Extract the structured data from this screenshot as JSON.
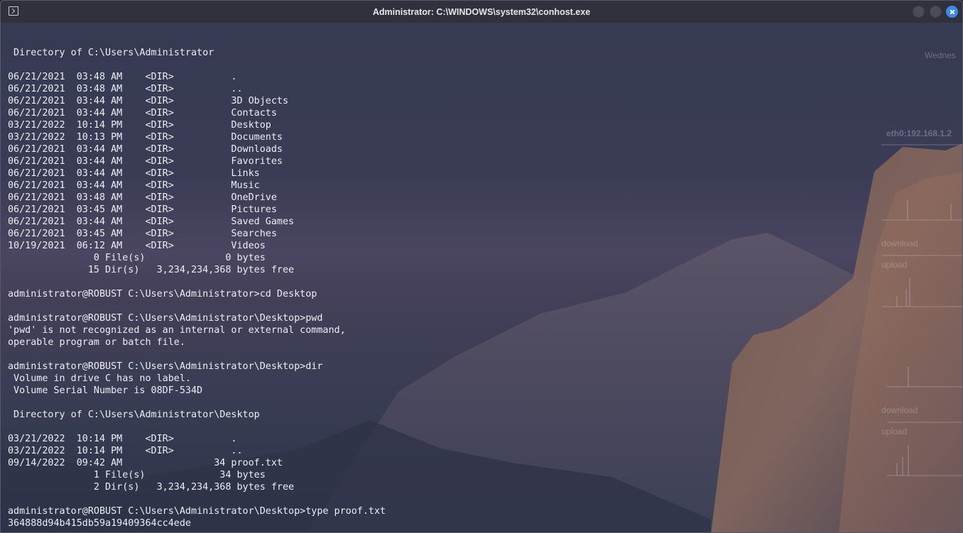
{
  "window": {
    "title": "Administrator: C:\\WINDOWS\\system32\\conhost.exe",
    "close_color": "#3d8ae6"
  },
  "console": {
    "lines": [
      "",
      "",
      " Directory of C:\\Users\\Administrator",
      "",
      "06/21/2021  03:48 AM    <DIR>          .",
      "06/21/2021  03:48 AM    <DIR>          ..",
      "06/21/2021  03:44 AM    <DIR>          3D Objects",
      "06/21/2021  03:44 AM    <DIR>          Contacts",
      "03/21/2022  10:14 PM    <DIR>          Desktop",
      "03/21/2022  10:13 PM    <DIR>          Documents",
      "06/21/2021  03:44 AM    <DIR>          Downloads",
      "06/21/2021  03:44 AM    <DIR>          Favorites",
      "06/21/2021  03:44 AM    <DIR>          Links",
      "06/21/2021  03:44 AM    <DIR>          Music",
      "06/21/2021  03:48 AM    <DIR>          OneDrive",
      "06/21/2021  03:45 AM    <DIR>          Pictures",
      "06/21/2021  03:44 AM    <DIR>          Saved Games",
      "06/21/2021  03:45 AM    <DIR>          Searches",
      "10/19/2021  06:12 AM    <DIR>          Videos",
      "               0 File(s)              0 bytes",
      "              15 Dir(s)   3,234,234,368 bytes free",
      "",
      "administrator@ROBUST C:\\Users\\Administrator>cd Desktop",
      "",
      "administrator@ROBUST C:\\Users\\Administrator\\Desktop>pwd",
      "'pwd' is not recognized as an internal or external command,",
      "operable program or batch file.",
      "",
      "administrator@ROBUST C:\\Users\\Administrator\\Desktop>dir",
      " Volume in drive C has no label.",
      " Volume Serial Number is 08DF-534D",
      "",
      " Directory of C:\\Users\\Administrator\\Desktop",
      "",
      "03/21/2022  10:14 PM    <DIR>          .",
      "03/21/2022  10:14 PM    <DIR>          ..",
      "09/14/2022  09:42 AM                34 proof.txt",
      "               1 File(s)             34 bytes",
      "               2 Dir(s)   3,234,234,368 bytes free",
      "",
      "administrator@ROBUST C:\\Users\\Administrator\\Desktop>type proof.txt",
      "364888d94b415db59a19409364cc4ede"
    ]
  },
  "desktop_widget": {
    "date_label": "Wednes",
    "network_label": "eth0:192.168.1.2",
    "download_label_1": "download",
    "upload_label_1": "upload",
    "download_label_2": "download",
    "upload_label_2": "upload"
  }
}
